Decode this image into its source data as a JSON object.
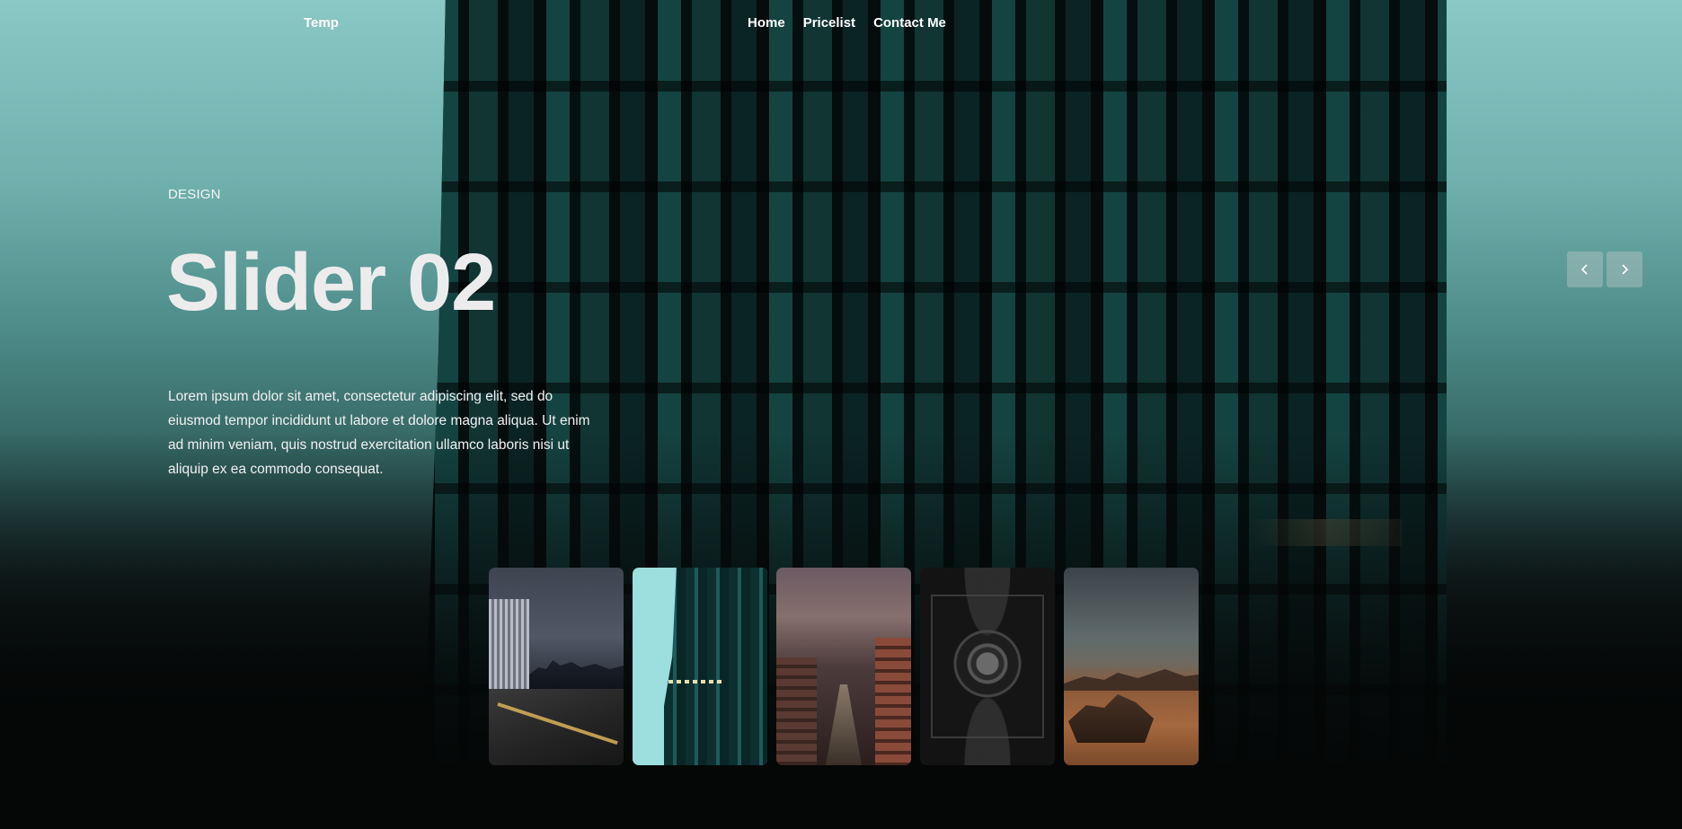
{
  "brand": {
    "name": "Temp"
  },
  "nav": {
    "items": [
      {
        "label": "Home"
      },
      {
        "label": "Pricelist"
      },
      {
        "label": "Contact Me"
      }
    ]
  },
  "slide": {
    "category": "DESIGN",
    "title": "Slider 02",
    "description": "Lorem ipsum dolor sit amet, consectetur adipiscing elit, sed do eiusmod tempor incididunt ut labore et dolore magna aliqua. Ut enim ad minim veniam, quis nostrud exercitation ullamco laboris nisi ut aliquip ex ea commodo consequat."
  },
  "controls": {
    "prev_icon": "chevron-left-icon",
    "next_icon": "chevron-right-icon"
  },
  "thumbnails": [
    {
      "name": "city-waterfront-night"
    },
    {
      "name": "glass-tower"
    },
    {
      "name": "city-canal-street"
    },
    {
      "name": "ornate-ceiling"
    },
    {
      "name": "desert-rocks"
    }
  ],
  "colors": {
    "sky_teal": "#8ac8c5",
    "background_dark": "#050707",
    "arrow_button_bg": "rgba(190,200,200,0.42)"
  }
}
